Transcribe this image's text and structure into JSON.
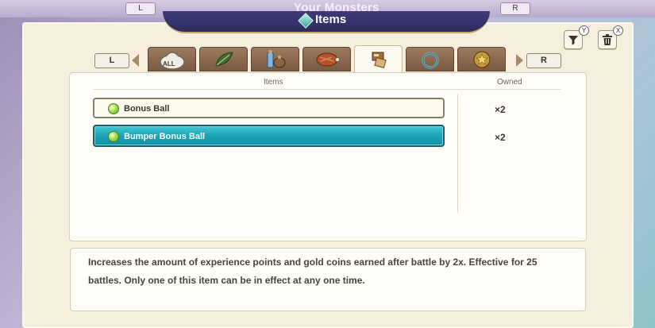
{
  "background_bar": {
    "title": "Your Monsters",
    "left_label": "L",
    "right_label": "R"
  },
  "header": {
    "title": "Items"
  },
  "top_buttons": {
    "filter_badge": "Y",
    "delete_badge": "X"
  },
  "tabs": {
    "left_button": "L",
    "right_button": "R",
    "all_label": "ALL",
    "items": [
      {
        "icon": "all-items-bag-icon"
      },
      {
        "icon": "herb-leaf-icon"
      },
      {
        "icon": "potion-bottles-icon"
      },
      {
        "icon": "roasted-meat-icon"
      },
      {
        "icon": "scroll-ticket-icon",
        "active": true
      },
      {
        "icon": "ring-accessory-icon"
      },
      {
        "icon": "star-medal-icon"
      }
    ]
  },
  "list": {
    "col_items": "Items",
    "col_owned": "Owned",
    "rows": [
      {
        "name": "Bonus Ball",
        "owned": "×2",
        "selected": false
      },
      {
        "name": "Bumper Bonus Ball",
        "owned": "×2",
        "selected": true
      }
    ]
  },
  "description": {
    "text": "Increases the amount of experience points and gold coins earned after battle by 2x. Effective for 25 battles. Only one of this item can be in effect at any one time."
  },
  "colors": {
    "panel": "#f7efde",
    "header_bg": "#2e2c5e",
    "selected_row": "#1aa4b5",
    "tab_bg": "#7a5a44"
  }
}
